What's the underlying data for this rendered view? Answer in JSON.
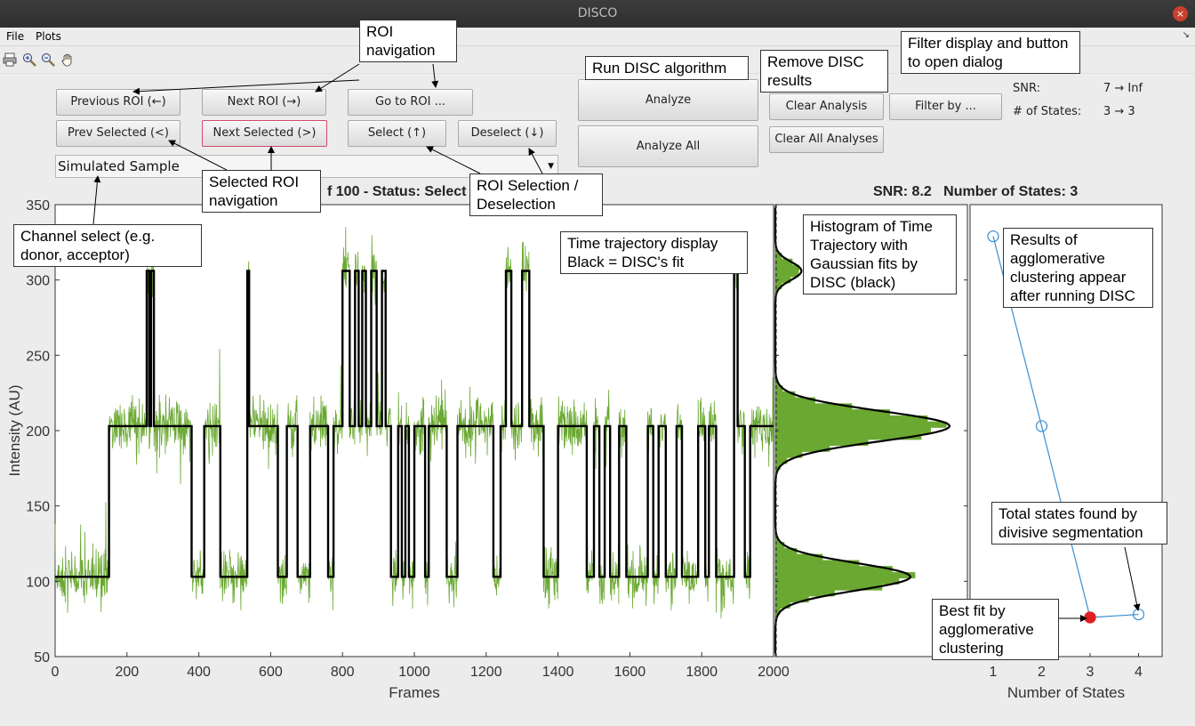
{
  "window": {
    "title": "DISCO",
    "close_glyph": "×"
  },
  "menu": {
    "file": "File",
    "plots": "Plots",
    "overflow_glyph": "↘"
  },
  "toolbar": {
    "icons": [
      "print-icon",
      "zoom-in-icon",
      "zoom-out-icon",
      "pan-hand-icon"
    ]
  },
  "buttons": {
    "prev_roi": "Previous ROI (←)",
    "next_roi": "Next ROI (→)",
    "goto_roi": "Go to ROI ...",
    "prev_selected": "Prev Selected (<)",
    "next_selected": "Next Selected (>)",
    "select": "Select (↑)",
    "deselect": "Deselect (↓)",
    "analyze": "Analyze",
    "analyze_all": "Analyze All",
    "clear_analysis": "Clear Analysis",
    "clear_all": "Clear All Analyses",
    "filter_by": "Filter by ..."
  },
  "channel_select": {
    "value": "Simulated Sample"
  },
  "filter_info": {
    "snr_label": "SNR:",
    "snr_value": "7 → Inf",
    "states_label": "# of States:",
    "states_value": "3 → 3"
  },
  "plot_titles": {
    "trajectory": "f 100 - Status: Select",
    "stats": "SNR: 8.2   Number of States: 3"
  },
  "callouts": {
    "roi_nav": "ROI navigation",
    "run_disc": "Run DISC algorithm",
    "remove_disc": "Remove DISC results",
    "filter_display": "Filter display and button to open dialog",
    "selected_roi_nav": "Selected ROI navigation",
    "roi_selection": "ROI Selection / Deselection",
    "channel_select": "Channel select (e.g. donor, acceptor)",
    "time_traj": "Time trajectory display Black = DISC's fit",
    "histogram": "Histogram of Time Trajectory with Gaussian fits by DISC (black)",
    "agglomerative": "Results of agglomerative clustering appear after running DISC",
    "divisive": "Total states found by divisive segmentation",
    "best_fit": "Best fit by agglomerative clustering"
  },
  "chart_data": [
    {
      "type": "line",
      "xlabel": "Frames",
      "ylabel": "Intensity (AU)",
      "xlim": [
        0,
        2000
      ],
      "ylim": [
        50,
        350
      ],
      "xticks": [
        0,
        200,
        400,
        600,
        800,
        1000,
        1200,
        1400,
        1600,
        1800,
        2000
      ],
      "yticks": [
        50,
        100,
        150,
        200,
        250,
        300,
        350
      ],
      "colors": {
        "trace": "#6aa832",
        "fit": "#000000"
      },
      "fit_levels": [
        103,
        203,
        306
      ],
      "fit_segments": [
        [
          0,
          150,
          103
        ],
        [
          150,
          255,
          203
        ],
        [
          255,
          262,
          306
        ],
        [
          262,
          267,
          203
        ],
        [
          267,
          275,
          306
        ],
        [
          275,
          380,
          203
        ],
        [
          380,
          415,
          103
        ],
        [
          415,
          460,
          203
        ],
        [
          460,
          535,
          103
        ],
        [
          535,
          540,
          306
        ],
        [
          540,
          620,
          203
        ],
        [
          620,
          645,
          103
        ],
        [
          645,
          675,
          203
        ],
        [
          675,
          710,
          103
        ],
        [
          710,
          760,
          203
        ],
        [
          760,
          775,
          103
        ],
        [
          775,
          800,
          203
        ],
        [
          800,
          820,
          306
        ],
        [
          820,
          835,
          203
        ],
        [
          835,
          845,
          306
        ],
        [
          845,
          855,
          203
        ],
        [
          855,
          865,
          306
        ],
        [
          865,
          880,
          203
        ],
        [
          880,
          895,
          306
        ],
        [
          895,
          910,
          203
        ],
        [
          910,
          920,
          306
        ],
        [
          920,
          935,
          203
        ],
        [
          935,
          955,
          103
        ],
        [
          955,
          965,
          203
        ],
        [
          965,
          975,
          103
        ],
        [
          975,
          985,
          203
        ],
        [
          985,
          1000,
          103
        ],
        [
          1000,
          1030,
          203
        ],
        [
          1030,
          1040,
          103
        ],
        [
          1040,
          1090,
          203
        ],
        [
          1090,
          1120,
          103
        ],
        [
          1120,
          1220,
          203
        ],
        [
          1220,
          1240,
          103
        ],
        [
          1240,
          1255,
          203
        ],
        [
          1255,
          1270,
          306
        ],
        [
          1270,
          1300,
          203
        ],
        [
          1300,
          1320,
          306
        ],
        [
          1320,
          1360,
          203
        ],
        [
          1360,
          1400,
          103
        ],
        [
          1400,
          1480,
          203
        ],
        [
          1480,
          1500,
          103
        ],
        [
          1500,
          1515,
          203
        ],
        [
          1515,
          1530,
          103
        ],
        [
          1530,
          1545,
          203
        ],
        [
          1545,
          1570,
          103
        ],
        [
          1570,
          1590,
          203
        ],
        [
          1590,
          1650,
          103
        ],
        [
          1650,
          1665,
          203
        ],
        [
          1665,
          1680,
          103
        ],
        [
          1680,
          1700,
          203
        ],
        [
          1700,
          1730,
          103
        ],
        [
          1730,
          1745,
          203
        ],
        [
          1745,
          1790,
          103
        ],
        [
          1790,
          1810,
          203
        ],
        [
          1810,
          1820,
          103
        ],
        [
          1820,
          1840,
          203
        ],
        [
          1840,
          1890,
          103
        ],
        [
          1890,
          1900,
          306
        ],
        [
          1900,
          1920,
          203
        ],
        [
          1920,
          1935,
          103
        ],
        [
          1935,
          2000,
          203
        ]
      ]
    },
    {
      "type": "bar",
      "orientation": "horizontal",
      "ylim": [
        50,
        350
      ],
      "colors": {
        "hist": "#6aa832",
        "fit": "#000000"
      },
      "gaussians": [
        {
          "mean": 103,
          "sd": 9,
          "amp": 0.62
        },
        {
          "mean": 203,
          "sd": 10,
          "amp": 0.8
        },
        {
          "mean": 306,
          "sd": 6,
          "amp": 0.12
        }
      ]
    },
    {
      "type": "line",
      "xlabel": "Number of States",
      "xticks": [
        1,
        2,
        3,
        4
      ],
      "colors": {
        "line": "#3a8ed0",
        "best": "#e02020"
      },
      "agglomerative": [
        {
          "states": 1,
          "y": 329
        },
        {
          "states": 2,
          "y": 203
        },
        {
          "states": 3,
          "y": 76
        }
      ],
      "divisive": [
        {
          "states": 3,
          "y": 76
        },
        {
          "states": 4,
          "y": 78
        }
      ],
      "best_fit_states": 3
    }
  ]
}
